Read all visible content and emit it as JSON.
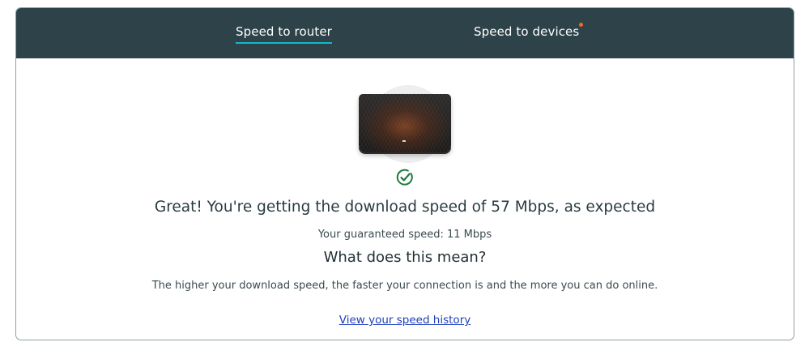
{
  "tabs": {
    "router_label": "Speed to router",
    "devices_label": "Speed to devices"
  },
  "result": {
    "headline": "Great! You're getting the download speed of 57 Mbps, as expected",
    "guaranteed": "Your guaranteed speed: 11 Mbps",
    "subheading": "What does this mean?",
    "explanation": "The higher your download speed, the faster your connection is and the more you can do online.",
    "history_link": "View your speed history"
  },
  "colors": {
    "header_bg": "#2d4249",
    "tab_underline": "#14b8c9",
    "notification_dot": "#f26a21",
    "success_green": "#1f7a3f",
    "link": "#1f3fbf"
  },
  "icons": {
    "status": "check-circle-icon",
    "device": "router-image"
  }
}
